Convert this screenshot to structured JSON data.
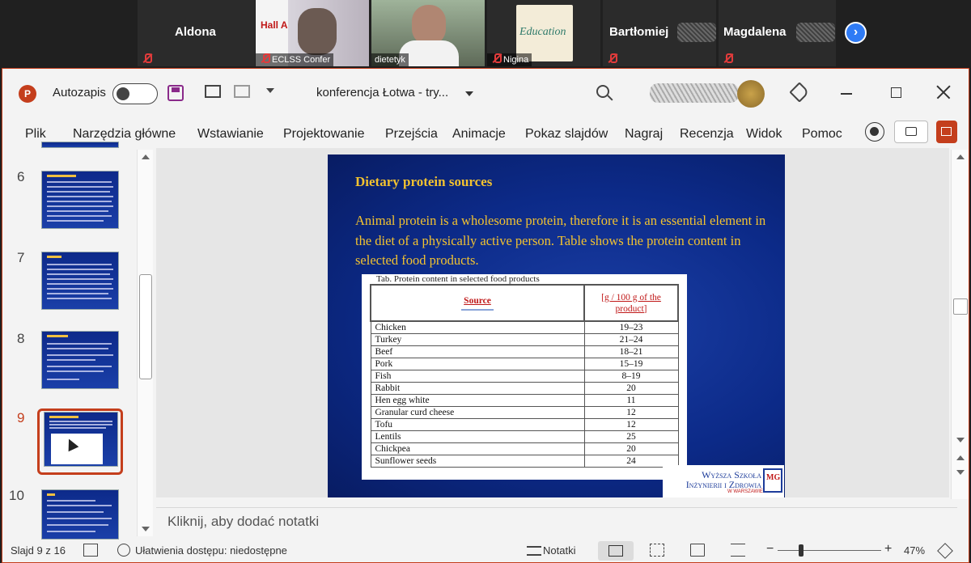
{
  "meeting": {
    "participants": [
      {
        "name": "Aldona"
      },
      {
        "name": "ECLSS Confer"
      },
      {
        "name": "dietetyk"
      },
      {
        "name": "Nigina"
      },
      {
        "name": "Bartłomiej"
      },
      {
        "name": "Magdalena"
      }
    ],
    "poster_text": "Hall A",
    "poster_book": "Education"
  },
  "app": {
    "autosave_label": "Autozapis",
    "doc_title": "konferencja Łotwa  -  try...",
    "tabs": [
      "Plik",
      "Narzędzia główne",
      "Wstawianie",
      "Projektowanie",
      "Przejścia",
      "Animacje",
      "Pokaz slajdów",
      "Nagraj",
      "Recenzja",
      "Widok",
      "Pomoc"
    ]
  },
  "thumbnails": [
    {
      "num": "6"
    },
    {
      "num": "7"
    },
    {
      "num": "8"
    },
    {
      "num": "9"
    },
    {
      "num": "10"
    }
  ],
  "slide": {
    "title": "Dietary protein sources",
    "body": "Animal protein is a wholesome protein, therefore it is an essential element in the diet of a physically active person. Table shows the protein content in selected food products.",
    "table_caption": "Tab. Protein content in selected food products",
    "col_source": "Source",
    "col_unit": "[g / 100 g of the product]",
    "rows": [
      {
        "food": "Chicken",
        "value": "19–23"
      },
      {
        "food": "Turkey",
        "value": "21–24"
      },
      {
        "food": "Beef",
        "value": "18–21"
      },
      {
        "food": "Pork",
        "value": "15–19"
      },
      {
        "food": "Fish",
        "value": "8–19"
      },
      {
        "food": "Rabbit",
        "value": "20"
      },
      {
        "food": "Hen egg white",
        "value": "11"
      },
      {
        "food": "Granular curd cheese",
        "value": "12"
      },
      {
        "food": "Tofu",
        "value": "12"
      },
      {
        "food": "Lentils",
        "value": "25"
      },
      {
        "food": "Chickpea",
        "value": "20"
      },
      {
        "food": "Sunflower seeds",
        "value": "24"
      }
    ],
    "logo_line1": "Wyższa Szkoła",
    "logo_line2": "Inżynierii i Zdrowia",
    "logo_line3": "W WARSZAWIE",
    "logo_mark": "MG"
  },
  "notes_placeholder": "Kliknij, aby dodać notatki",
  "status": {
    "slide_info": "Slajd 9 z 16",
    "accessibility": "Ułatwienia dostępu: niedostępne",
    "notes_btn": "Notatki",
    "zoom": "47%"
  },
  "colors": {
    "accent": "#c43e1c",
    "slide_bg": "#0c2a88",
    "slide_text": "#f2c230",
    "teams_blue": "#2f7bf5"
  }
}
